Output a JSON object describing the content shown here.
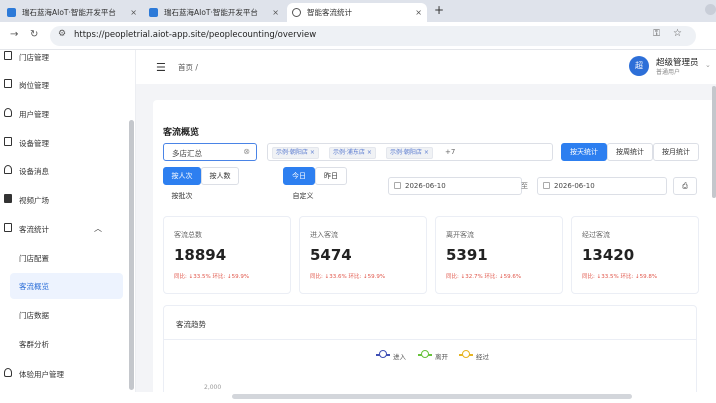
{
  "browser": {
    "tabs": [
      {
        "title": "瑞石蓝海AIoT·智能开发平台"
      },
      {
        "title": "瑞石蓝海AIoT·智能开发平台"
      },
      {
        "title": "智能客流统计"
      }
    ],
    "url": "https://peopletrial.aiot-app.site/peoplecounting/overview"
  },
  "sidebar": {
    "items": [
      {
        "label": "门店管理"
      },
      {
        "label": "岗位管理"
      },
      {
        "label": "用户管理"
      },
      {
        "label": "设备管理"
      },
      {
        "label": "设备消息"
      },
      {
        "label": "视频广场"
      },
      {
        "label": "客流统计"
      },
      {
        "label": "门店配置"
      },
      {
        "label": "客流概览"
      },
      {
        "label": "门店数据"
      },
      {
        "label": "客群分析"
      },
      {
        "label": "体验用户管理"
      }
    ]
  },
  "header": {
    "breadcrumb": "首页",
    "breadcrumb_sep": "/",
    "avatar_char": "超",
    "user_name": "超级管理员",
    "user_role": "普通用户"
  },
  "overview": {
    "title": "客流概览",
    "store_select": "多店汇总",
    "store_tags": [
      "示例·朝阳店",
      "示例·浦东店",
      "示例·朝阳店"
    ],
    "more_tags": "+7",
    "stat_mode_buttons": [
      "按天统计",
      "按周统计",
      "按月统计"
    ],
    "count_mode_buttons": [
      "按人次",
      "按人数",
      "按批次"
    ],
    "day_buttons": [
      "今日",
      "昨日",
      "自定义"
    ],
    "date_start": "2026-06-10",
    "date_sep": "至",
    "date_end": "2026-06-10",
    "cards": [
      {
        "label": "客流总数",
        "value": "18894",
        "yoy": "同比: ↓33.5%",
        "mom": "环比: ↓59.9%"
      },
      {
        "label": "进入客流",
        "value": "5474",
        "yoy": "同比: ↓33.6%",
        "mom": "环比: ↓59.9%"
      },
      {
        "label": "离开客流",
        "value": "5391",
        "yoy": "同比: ↓32.7%",
        "mom": "环比: ↓59.6%"
      },
      {
        "label": "经过客流",
        "value": "13420",
        "yoy": "同比: ↓33.5%",
        "mom": "环比: ↓59.8%"
      }
    ],
    "trend": {
      "title": "客流趋势",
      "legend": [
        {
          "name": "进入",
          "color": "#3f4fb5"
        },
        {
          "name": "离开",
          "color": "#67c23a"
        },
        {
          "name": "经过",
          "color": "#e6b422"
        }
      ],
      "y_top_label": "2,000"
    }
  },
  "colors": {
    "primary": "#2d7ff0",
    "down": "#e0564a"
  }
}
